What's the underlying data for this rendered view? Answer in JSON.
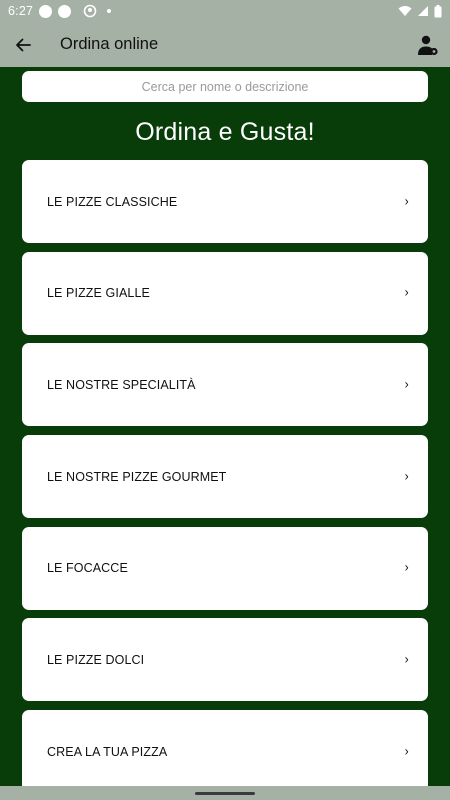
{
  "status_bar": {
    "time": "6:27"
  },
  "app_bar": {
    "title": "Ordina online",
    "back_icon": "arrow-left-icon",
    "account_icon": "user-settings-icon"
  },
  "search": {
    "placeholder": "Cerca per nome o descrizione"
  },
  "heading": "Ordina e Gusta!",
  "categories": [
    {
      "label": "LE PIZZE CLASSICHE"
    },
    {
      "label": "LE PIZZE GIALLE"
    },
    {
      "label": "LE NOSTRE SPECIALITÀ"
    },
    {
      "label": "LE NOSTRE PIZZE GOURMET"
    },
    {
      "label": "LE FOCACCE"
    },
    {
      "label": "LE PIZZE DOLCI"
    },
    {
      "label": "CREA LA TUA PIZZA"
    }
  ],
  "chevron_glyph": "›",
  "colors": {
    "background": "#083d09",
    "bars": "#a6b1a6",
    "card": "#ffffff"
  }
}
